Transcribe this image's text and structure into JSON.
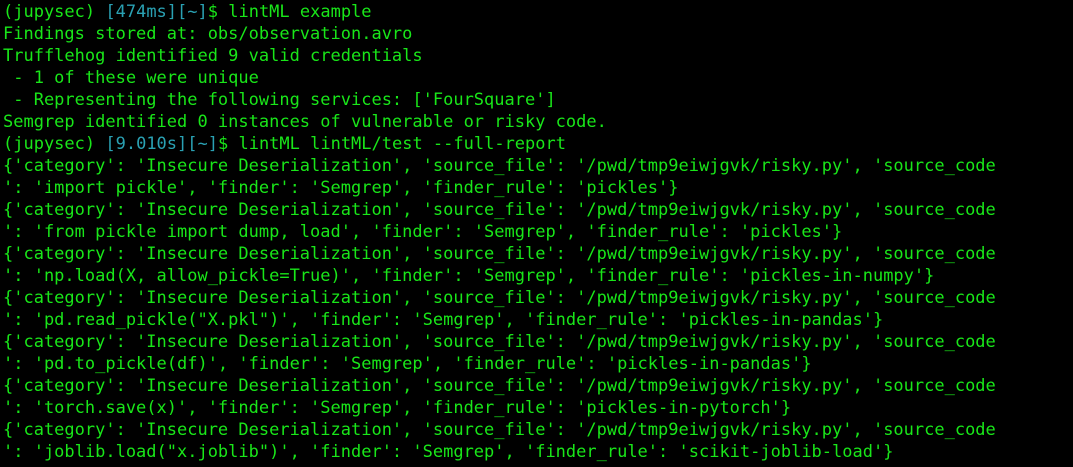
{
  "colors": {
    "background": "#000000",
    "text": "#19e619",
    "prompt_meta": "#2aa1b3"
  },
  "session_1": {
    "env": "(jupysec)",
    "time_and_dir": "[474ms][~]",
    "sigil": "$",
    "command": "lintML example",
    "output": [
      "Findings stored at: obs/observation.avro",
      "Trufflehog identified 9 valid credentials",
      " - 1 of these were unique",
      " - Representing the following services: ['FourSquare']",
      "Semgrep identified 0 instances of vulnerable or risky code."
    ]
  },
  "session_2": {
    "env": "(jupysec)",
    "time_and_dir": "[9.010s][~]",
    "sigil": "$",
    "command": "lintML lintML/test --full-report",
    "output": [
      "{'category': 'Insecure Deserialization', 'source_file': '/pwd/tmp9eiwjgvk/risky.py', 'source_code",
      "': 'import pickle', 'finder': 'Semgrep', 'finder_rule': 'pickles'}",
      "{'category': 'Insecure Deserialization', 'source_file': '/pwd/tmp9eiwjgvk/risky.py', 'source_code",
      "': 'from pickle import dump, load', 'finder': 'Semgrep', 'finder_rule': 'pickles'}",
      "{'category': 'Insecure Deserialization', 'source_file': '/pwd/tmp9eiwjgvk/risky.py', 'source_code",
      "': 'np.load(X, allow_pickle=True)', 'finder': 'Semgrep', 'finder_rule': 'pickles-in-numpy'}",
      "{'category': 'Insecure Deserialization', 'source_file': '/pwd/tmp9eiwjgvk/risky.py', 'source_code",
      "': 'pd.read_pickle(\"X.pkl\")', 'finder': 'Semgrep', 'finder_rule': 'pickles-in-pandas'}",
      "{'category': 'Insecure Deserialization', 'source_file': '/pwd/tmp9eiwjgvk/risky.py', 'source_code",
      "': 'pd.to_pickle(df)', 'finder': 'Semgrep', 'finder_rule': 'pickles-in-pandas'}",
      "{'category': 'Insecure Deserialization', 'source_file': '/pwd/tmp9eiwjgvk/risky.py', 'source_code",
      "': 'torch.save(x)', 'finder': 'Semgrep', 'finder_rule': 'pickles-in-pytorch'}",
      "{'category': 'Insecure Deserialization', 'source_file': '/pwd/tmp9eiwjgvk/risky.py', 'source_code",
      "': 'joblib.load(\"x.joblib\")', 'finder': 'Semgrep', 'finder_rule': 'scikit-joblib-load'}"
    ]
  }
}
